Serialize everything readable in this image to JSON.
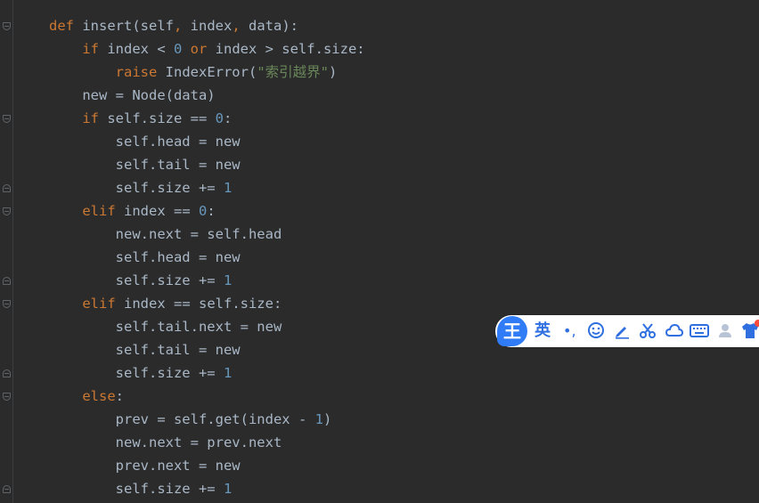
{
  "code_lines": [
    {
      "indent": "",
      "tokens": [
        {
          "t": "def ",
          "c": "kw"
        },
        {
          "t": "insert",
          "c": "plain"
        },
        {
          "t": "(",
          "c": "plain"
        },
        {
          "t": "self",
          "c": "plain"
        },
        {
          "t": ", ",
          "c": "punc"
        },
        {
          "t": "index",
          "c": "plain"
        },
        {
          "t": ", ",
          "c": "punc"
        },
        {
          "t": "data",
          "c": "plain"
        },
        {
          "t": "):",
          "c": "plain"
        }
      ]
    },
    {
      "indent": "    ",
      "tokens": [
        {
          "t": "if ",
          "c": "kw"
        },
        {
          "t": "index < ",
          "c": "plain"
        },
        {
          "t": "0",
          "c": "num"
        },
        {
          "t": " or ",
          "c": "kw"
        },
        {
          "t": "index > self.size:",
          "c": "plain"
        }
      ]
    },
    {
      "indent": "        ",
      "tokens": [
        {
          "t": "raise ",
          "c": "kw"
        },
        {
          "t": "IndexError(",
          "c": "plain"
        },
        {
          "t": "\"索引越界\"",
          "c": "str"
        },
        {
          "t": ")",
          "c": "plain"
        }
      ]
    },
    {
      "indent": "    ",
      "tokens": [
        {
          "t": "new = Node(data)",
          "c": "plain"
        }
      ]
    },
    {
      "indent": "    ",
      "tokens": [
        {
          "t": "if ",
          "c": "kw"
        },
        {
          "t": "self.size == ",
          "c": "plain"
        },
        {
          "t": "0",
          "c": "num"
        },
        {
          "t": ":",
          "c": "plain"
        }
      ]
    },
    {
      "indent": "        ",
      "tokens": [
        {
          "t": "self.head = new",
          "c": "plain"
        }
      ]
    },
    {
      "indent": "        ",
      "tokens": [
        {
          "t": "self.tail = new",
          "c": "plain"
        }
      ]
    },
    {
      "indent": "        ",
      "tokens": [
        {
          "t": "self.size += ",
          "c": "plain"
        },
        {
          "t": "1",
          "c": "num"
        }
      ]
    },
    {
      "indent": "    ",
      "tokens": [
        {
          "t": "elif ",
          "c": "kw"
        },
        {
          "t": "index == ",
          "c": "plain"
        },
        {
          "t": "0",
          "c": "num"
        },
        {
          "t": ":",
          "c": "plain"
        }
      ]
    },
    {
      "indent": "        ",
      "tokens": [
        {
          "t": "new.next = self.head",
          "c": "plain"
        }
      ]
    },
    {
      "indent": "        ",
      "tokens": [
        {
          "t": "self.head = new",
          "c": "plain"
        }
      ]
    },
    {
      "indent": "        ",
      "tokens": [
        {
          "t": "self.size += ",
          "c": "plain"
        },
        {
          "t": "1",
          "c": "num"
        }
      ]
    },
    {
      "indent": "    ",
      "tokens": [
        {
          "t": "elif ",
          "c": "kw"
        },
        {
          "t": "index == self.size:",
          "c": "plain"
        }
      ]
    },
    {
      "indent": "        ",
      "tokens": [
        {
          "t": "self.tail.next = new",
          "c": "plain"
        }
      ]
    },
    {
      "indent": "        ",
      "tokens": [
        {
          "t": "self.tail = new",
          "c": "plain"
        }
      ]
    },
    {
      "indent": "        ",
      "tokens": [
        {
          "t": "self.size += ",
          "c": "plain"
        },
        {
          "t": "1",
          "c": "num"
        }
      ]
    },
    {
      "indent": "    ",
      "tokens": [
        {
          "t": "else",
          "c": "kw"
        },
        {
          "t": ":",
          "c": "plain"
        }
      ]
    },
    {
      "indent": "        ",
      "tokens": [
        {
          "t": "prev = self.get(index - ",
          "c": "plain"
        },
        {
          "t": "1",
          "c": "num"
        },
        {
          "t": ")",
          "c": "plain"
        }
      ]
    },
    {
      "indent": "        ",
      "tokens": [
        {
          "t": "new.next = prev.next",
          "c": "plain"
        }
      ]
    },
    {
      "indent": "        ",
      "tokens": [
        {
          "t": "prev.next = new",
          "c": "plain"
        }
      ]
    },
    {
      "indent": "        ",
      "tokens": [
        {
          "t": "self.size += ",
          "c": "plain"
        },
        {
          "t": "1",
          "c": "num"
        }
      ]
    }
  ],
  "fold_markers": [
    {
      "line": 0,
      "kind": "start"
    },
    {
      "line": 4,
      "kind": "start"
    },
    {
      "line": 7,
      "kind": "end"
    },
    {
      "line": 8,
      "kind": "start"
    },
    {
      "line": 11,
      "kind": "end"
    },
    {
      "line": 12,
      "kind": "start"
    },
    {
      "line": 15,
      "kind": "end"
    },
    {
      "line": 16,
      "kind": "start"
    },
    {
      "line": 20,
      "kind": "end"
    }
  ],
  "ime_toolbar": {
    "logo": "王",
    "language": "英",
    "punctuation": "•,",
    "icons": [
      "emoji-icon",
      "pen-icon",
      "scissors-icon",
      "cloud-icon",
      "keyboard-icon",
      "user-icon",
      "skin-shirt-icon"
    ]
  },
  "colors": {
    "background": "#2b2b2b",
    "keyword": "#cc7832",
    "number": "#6897bb",
    "string": "#6a8759",
    "text": "#a9b7c6",
    "ime_accent": "#2f7cf6"
  }
}
